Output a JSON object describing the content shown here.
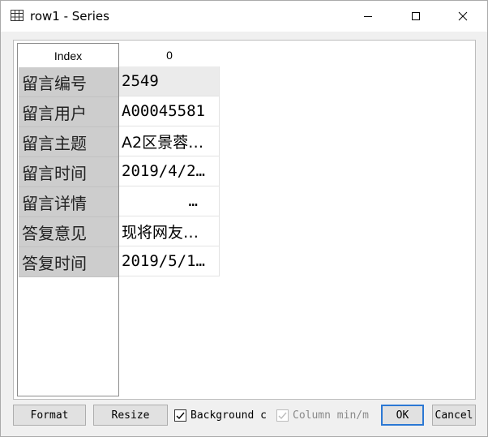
{
  "window": {
    "title": "row1 - Series"
  },
  "table": {
    "index_header": "Index",
    "column_header": "0",
    "rows": [
      {
        "label": "留言编号",
        "value": "2549"
      },
      {
        "label": "留言用户",
        "value": "A00045581"
      },
      {
        "label": "留言主题",
        "value": "A2区景蓉…"
      },
      {
        "label": "留言时间",
        "value": "2019/4/2…"
      },
      {
        "label": "留言详情",
        "value": "…"
      },
      {
        "label": "答复意见",
        "value": "现将网友…"
      },
      {
        "label": "答复时间",
        "value": "2019/5/1…"
      }
    ]
  },
  "controls": {
    "format_label": "Format",
    "resize_label": "Resize",
    "background_label": "Background c",
    "background_checked": true,
    "column_minmax_label": "Column min/m",
    "column_minmax_checked": true,
    "column_minmax_enabled": false,
    "ok_label": "OK",
    "cancel_label": "Cancel"
  }
}
